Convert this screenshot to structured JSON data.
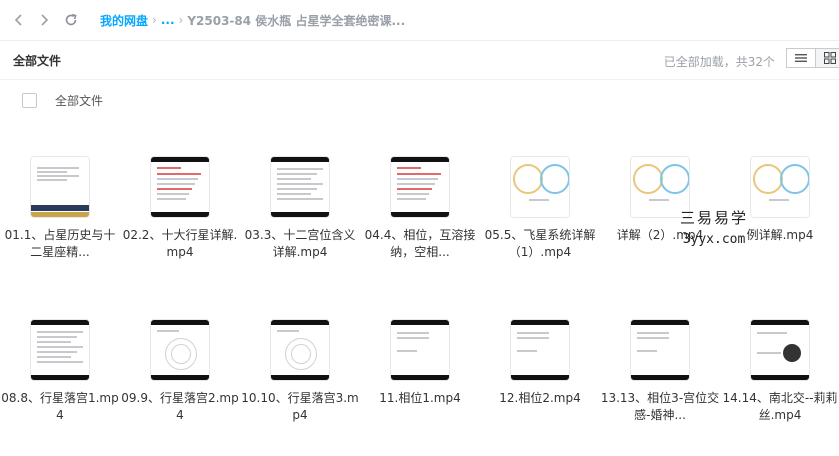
{
  "breadcrumb": {
    "root": "我的网盘",
    "ellipsis": "...",
    "current": "Y2503-84 侯水瓶 占星学全套绝密课..."
  },
  "toolbar": {
    "title": "全部文件",
    "status": "已全部加载，共32个"
  },
  "select_all": {
    "label": "全部文件",
    "checked": false
  },
  "files": [
    {
      "name": "01.1、占星历史与十二星座精...",
      "thumb": "doc-navy"
    },
    {
      "name": "02.2、十大行星详解.mp4",
      "thumb": "doc-red"
    },
    {
      "name": "03.3、十二宫位含义详解.mp4",
      "thumb": "doc-lines"
    },
    {
      "name": "04.4、相位，互溶接纳，空相...",
      "thumb": "doc-red"
    },
    {
      "name": "05.5、飞星系统详解（1）.mp4",
      "thumb": "wheels"
    },
    {
      "name": "详解（2）.mp4",
      "thumb": "wheels"
    },
    {
      "name": "例详解.mp4",
      "thumb": "wheels"
    },
    {
      "name": "08.8、行星落宫1.mp4",
      "thumb": "doc-lines"
    },
    {
      "name": "09.9、行星落宫2.mp4",
      "thumb": "chart-circle"
    },
    {
      "name": "10.10、行星落宫3.mp4",
      "thumb": "chart-circle"
    },
    {
      "name": "11.相位1.mp4",
      "thumb": "doc-sparse"
    },
    {
      "name": "12.相位2.mp4",
      "thumb": "doc-sparse"
    },
    {
      "name": "13.13、相位3-宫位交感-婚神...",
      "thumb": "doc-sparse"
    },
    {
      "name": "14.14、南北交--莉莉丝.mp4",
      "thumb": "diagram"
    }
  ],
  "watermark": {
    "line1": "三易易学",
    "line2": "3yyx.com"
  },
  "colors": {
    "accent": "#06a7ff",
    "muted": "#9aa0a8"
  },
  "icons": [
    "back-arrow-icon",
    "forward-arrow-icon",
    "refresh-icon",
    "list-view-icon",
    "grid-view-icon"
  ]
}
